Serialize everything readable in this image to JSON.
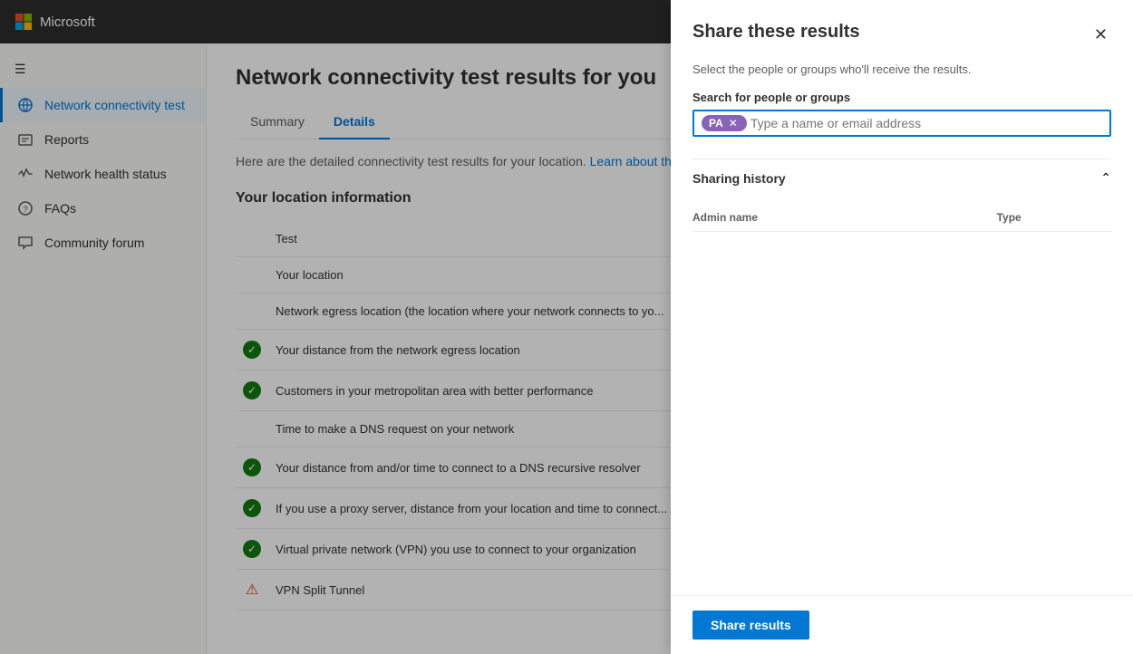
{
  "topbar": {
    "logo_text": "Microsoft"
  },
  "sidebar": {
    "items": [
      {
        "id": "network-connectivity",
        "label": "Network connectivity test",
        "icon": "🌐",
        "active": true
      },
      {
        "id": "reports",
        "label": "Reports",
        "icon": "📊",
        "active": false
      },
      {
        "id": "network-health",
        "label": "Network health status",
        "icon": "❤️",
        "active": false
      },
      {
        "id": "faqs",
        "label": "FAQs",
        "icon": "❓",
        "active": false
      },
      {
        "id": "community-forum",
        "label": "Community forum",
        "icon": "💬",
        "active": false
      }
    ]
  },
  "content": {
    "page_title": "Network connectivity test results for you",
    "tabs": [
      {
        "label": "Summary",
        "active": false
      },
      {
        "label": "Details",
        "active": true
      }
    ],
    "intro_text": "Here are the detailed connectivity test results for your location.",
    "intro_link_text": "Learn about the tests",
    "section_title": "Your location information",
    "rows": [
      {
        "status": "none",
        "text": "Test"
      },
      {
        "status": "none",
        "text": "Your location"
      },
      {
        "status": "none",
        "text": "Network egress location (the location where your network connects to yo..."
      },
      {
        "status": "ok",
        "text": "Your distance from the network egress location"
      },
      {
        "status": "ok",
        "text": "Customers in your metropolitan area with better performance"
      },
      {
        "status": "none",
        "text": "Time to make a DNS request on your network"
      },
      {
        "status": "ok",
        "text": "Your distance from and/or time to connect to a DNS recursive resolver"
      },
      {
        "status": "ok",
        "text": "If you use a proxy server, distance from your location and time to connect..."
      },
      {
        "status": "ok",
        "text": "Virtual private network (VPN) you use to connect to your organization"
      },
      {
        "status": "warn",
        "text": "VPN Split Tunnel"
      }
    ]
  },
  "modal": {
    "title": "Share these results",
    "subtitle": "Select the people or groups who'll receive the results.",
    "search_label": "Search for people or groups",
    "search_placeholder": "Type a name or email address",
    "tag_initials": "PA",
    "sharing_history_title": "Sharing history",
    "table_headers": [
      "Admin name",
      "Type"
    ],
    "share_button_label": "Share results"
  }
}
